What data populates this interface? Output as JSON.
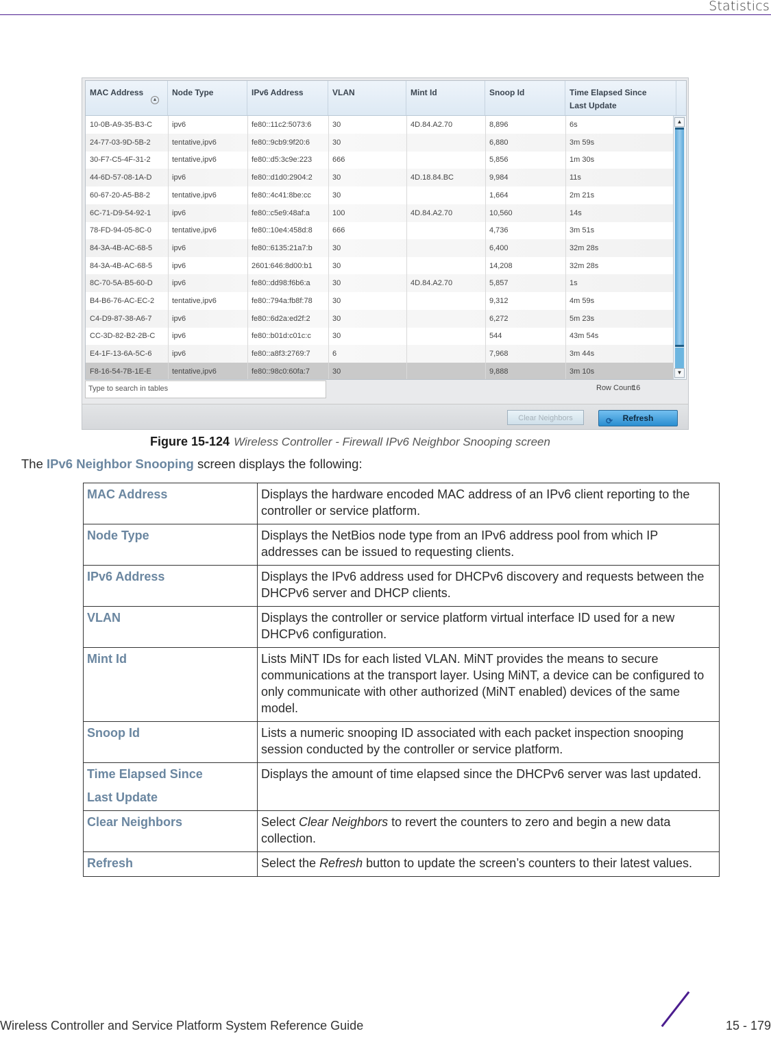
{
  "header": {
    "section_title": "Statistics"
  },
  "screenshot": {
    "columns": [
      "MAC Address",
      "Node Type",
      "IPv6 Address",
      "VLAN",
      "Mint Id",
      "Snoop Id",
      "Time Elapsed Since Last Update"
    ],
    "column_header_lines": [
      [
        "MAC Address"
      ],
      [
        "Node Type"
      ],
      [
        "IPv6 Address"
      ],
      [
        "VLAN"
      ],
      [
        "Mint Id"
      ],
      [
        "Snoop Id"
      ],
      [
        "Time Elapsed Since",
        "Last Update"
      ]
    ],
    "rows": [
      [
        "10-0B-A9-35-B3-C",
        "ipv6",
        "fe80::11c2:5073:6",
        "30",
        "4D.84.A2.70",
        "8,896",
        "6s"
      ],
      [
        "24-77-03-9D-5B-2",
        "tentative,ipv6",
        "fe80::9cb9:9f20:6",
        "30",
        "",
        "6,880",
        "3m 59s"
      ],
      [
        "30-F7-C5-4F-31-2",
        "tentative,ipv6",
        "fe80::d5:3c9e:223",
        "666",
        "",
        "5,856",
        "1m 30s"
      ],
      [
        "44-6D-57-08-1A-D",
        "ipv6",
        "fe80::d1d0:2904:2",
        "30",
        "4D.18.84.BC",
        "9,984",
        "11s"
      ],
      [
        "60-67-20-A5-B8-2",
        "tentative,ipv6",
        "fe80::4c41:8be:cc",
        "30",
        "",
        "1,664",
        "2m 21s"
      ],
      [
        "6C-71-D9-54-92-1",
        "ipv6",
        "fe80::c5e9:48af:a",
        "100",
        "4D.84.A2.70",
        "10,560",
        "14s"
      ],
      [
        "78-FD-94-05-8C-0",
        "tentative,ipv6",
        "fe80::10e4:458d:8",
        "666",
        "",
        "4,736",
        "3m 51s"
      ],
      [
        "84-3A-4B-AC-68-5",
        "ipv6",
        "fe80::6135:21a7:b",
        "30",
        "",
        "6,400",
        "32m 28s"
      ],
      [
        "84-3A-4B-AC-68-5",
        "ipv6",
        "2601:646:8d00:b1",
        "30",
        "",
        "14,208",
        "32m 28s"
      ],
      [
        "8C-70-5A-B5-60-D",
        "ipv6",
        "fe80::dd98:f6b6:a",
        "30",
        "4D.84.A2.70",
        "5,857",
        "1s"
      ],
      [
        "B4-B6-76-AC-EC-2",
        "tentative,ipv6",
        "fe80::794a:fb8f:78",
        "30",
        "",
        "9,312",
        "4m 59s"
      ],
      [
        "C4-D9-87-38-A6-7",
        "ipv6",
        "fe80::6d2a:ed2f:2",
        "30",
        "",
        "6,272",
        "5m 23s"
      ],
      [
        "CC-3D-82-B2-2B-C",
        "ipv6",
        "fe80::b01d:c01c:c",
        "30",
        "",
        "544",
        "43m 54s"
      ],
      [
        "E4-1F-13-6A-5C-6",
        "ipv6",
        "fe80::a8f3:2769:7",
        "6",
        "",
        "7,968",
        "3m 44s"
      ],
      [
        "F8-16-54-7B-1E-E",
        "tentative,ipv6",
        "fe80::98c0:60fa:7",
        "30",
        "",
        "9,888",
        "3m 10s"
      ]
    ],
    "selected_row_index": 14,
    "search_placeholder": "Type to search in tables",
    "row_count_label": "Row Count:",
    "row_count_value": "16",
    "clear_button": "Clear Neighbors",
    "refresh_button": "Refresh"
  },
  "caption": {
    "number": "Figure 15-124",
    "text": "Wireless Controller - Firewall IPv6 Neighbor Snooping screen"
  },
  "intro": {
    "before": "The ",
    "highlight": "IPv6 Neighbor Snooping",
    "after": " screen displays the following:"
  },
  "descriptions": [
    {
      "term": "MAC Address",
      "definition": "Displays the hardware encoded MAC address of an IPv6 client reporting to the controller or service platform."
    },
    {
      "term": "Node Type",
      "definition": "Displays the NetBios node type from an IPv6 address pool from which IP addresses can be issued to requesting clients."
    },
    {
      "term": "IPv6 Address",
      "definition": "Displays the IPv6 address used for DHCPv6 discovery and requests between the DHCPv6 server and DHCP clients."
    },
    {
      "term": "VLAN",
      "definition": "Displays the controller or service platform virtual interface ID used for a new DHCPv6 configuration."
    },
    {
      "term": "Mint Id",
      "definition": "Lists MiNT IDs for each listed VLAN. MiNT provides the means to secure communications at the transport layer. Using MiNT, a device can be configured to only communicate with other authorized (MiNT enabled) devices of the same model."
    },
    {
      "term": "Snoop Id",
      "definition": "Lists a numeric snooping ID associated with each packet inspection snooping session conducted by the controller or service platform."
    },
    {
      "term": "Time Elapsed Since",
      "term_line2": "Last Update",
      "definition": "Displays the amount of time elapsed since the DHCPv6 server was last updated."
    },
    {
      "term": "Clear Neighbors",
      "definition_before": "Select ",
      "definition_em": "Clear Neighbors",
      "definition_after": " to revert the counters to zero and begin a new data collection."
    },
    {
      "term": "Refresh",
      "definition_before": "Select the ",
      "definition_em": "Refresh",
      "definition_after": " button to update the screen’s counters to their latest values."
    }
  ],
  "footer": {
    "guide_title": "Wireless Controller and Service Platform System Reference Guide",
    "page_number": "15 - 179"
  },
  "colors": {
    "accent_purple": "#4b1d8f",
    "term_blue": "#6a86a0",
    "refresh_button": "#2a8ed0"
  }
}
